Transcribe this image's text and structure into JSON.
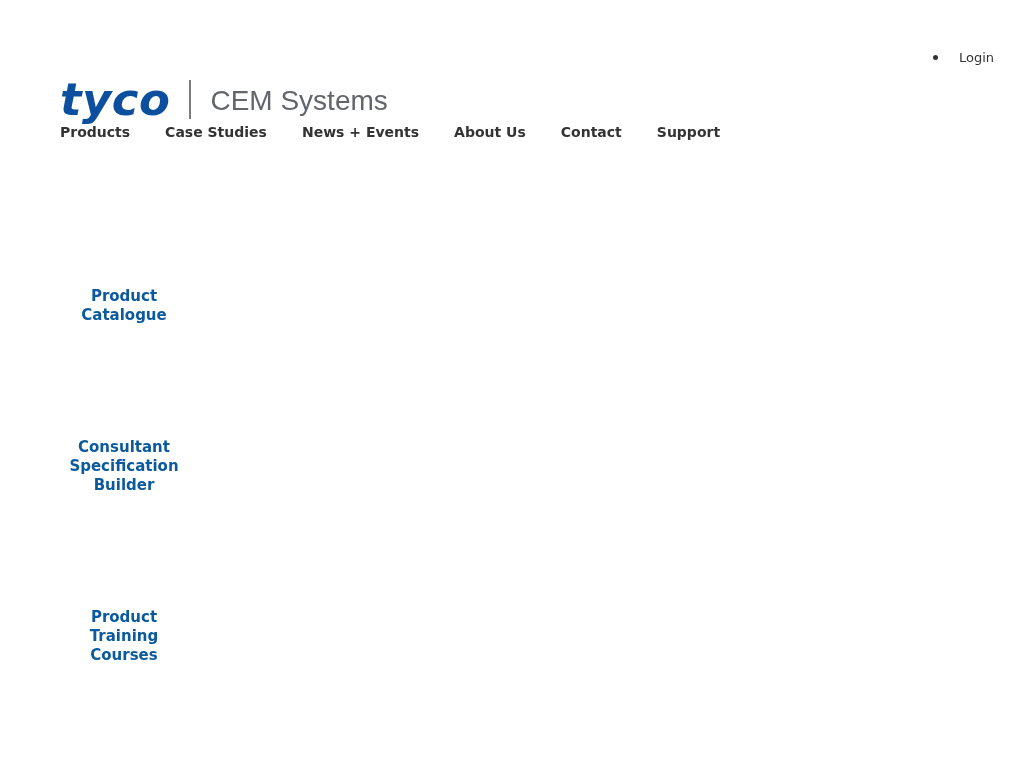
{
  "top_links": [
    {
      "label": "Login"
    }
  ],
  "logo": {
    "brand": "tyco",
    "product": "CEM Systems"
  },
  "nav": [
    {
      "label": "Products"
    },
    {
      "label": "Case Studies"
    },
    {
      "label": "News + Events"
    },
    {
      "label": "About Us"
    },
    {
      "label": "Contact"
    },
    {
      "label": "Support"
    }
  ],
  "quick_links": [
    {
      "label": "Product Catalogue"
    },
    {
      "label": "Consultant Specification Builder"
    },
    {
      "label": "Product Training Courses"
    }
  ]
}
